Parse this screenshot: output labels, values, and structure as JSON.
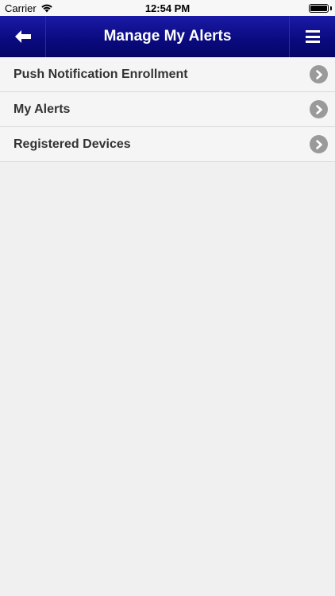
{
  "status_bar": {
    "carrier": "Carrier",
    "time": "12:54 PM"
  },
  "header": {
    "title": "Manage My Alerts",
    "back_icon": "arrow-left-icon",
    "menu_icon": "hamburger-menu-icon",
    "color": "#0d0d85"
  },
  "menu": {
    "items": [
      {
        "label": "Push Notification Enrollment",
        "icon": "chevron-right-icon"
      },
      {
        "label": "My Alerts",
        "icon": "chevron-right-icon"
      },
      {
        "label": "Registered Devices",
        "icon": "chevron-right-icon"
      }
    ]
  }
}
